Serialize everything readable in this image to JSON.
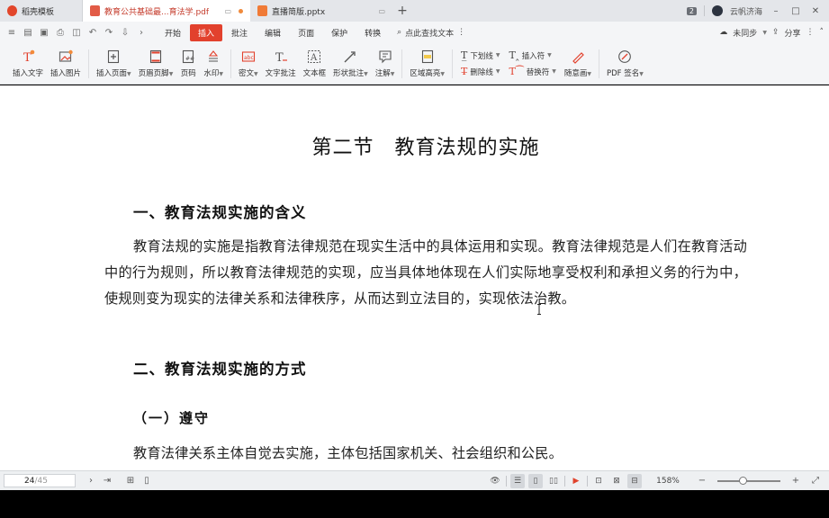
{
  "tabs": {
    "home_label": "稻壳模板",
    "active_label": "教育公共基础最...育法学.pdf",
    "other_label": "直播简版.pptx",
    "new_tab": "+",
    "badge": "2",
    "user_name": "云帆济海"
  },
  "menu": {
    "items": [
      "开始",
      "插入",
      "批注",
      "编辑",
      "页面",
      "保护",
      "转换"
    ],
    "active_index": 1,
    "search_label": "点此查找文本",
    "sync_label": "未同步",
    "share_label": "分享"
  },
  "ribbon": {
    "insert_text": "插入文字",
    "insert_image": "插入图片",
    "insert_page": "插入页面",
    "header_footer": "页眉页脚",
    "page_number": "页码",
    "watermark": "水印",
    "redact": "密文",
    "text_comment": "文字批注",
    "text_box": "文本框",
    "shape_comment": "形状批注",
    "note": "注解",
    "area_highlight": "区域高亮",
    "underline": "下划线",
    "strikethrough": "删除线",
    "insert_symbol": "插入符",
    "replace_symbol": "替换符",
    "freehand": "随意画",
    "pdf_sign": "PDF 签名"
  },
  "document": {
    "title": "第二节　教育法规的实施",
    "section1": "一、教育法规实施的含义",
    "para1": "教育法规的实施是指教育法律规范在现实生活中的具体运用和实现。教育法律规范是人们在教育活动中的行为规则，所以教育法律规范的实现，应当具体地体现在人们实际地享受权利和承担义务的行为中，使规则变为现实的法律关系和法律秩序，从而达到立法目的，实现依法治教。",
    "section2": "二、教育法规实施的方式",
    "subsection1": "（一）遵守",
    "para2": "教育法律关系主体自觉去实施，主体包括国家机关、社会组织和公民。"
  },
  "status": {
    "current_page": "24",
    "total_pages": "/45",
    "zoom": "158%"
  },
  "colors": {
    "accent": "#e2412d",
    "tab_active_text": "#c43a2a"
  }
}
